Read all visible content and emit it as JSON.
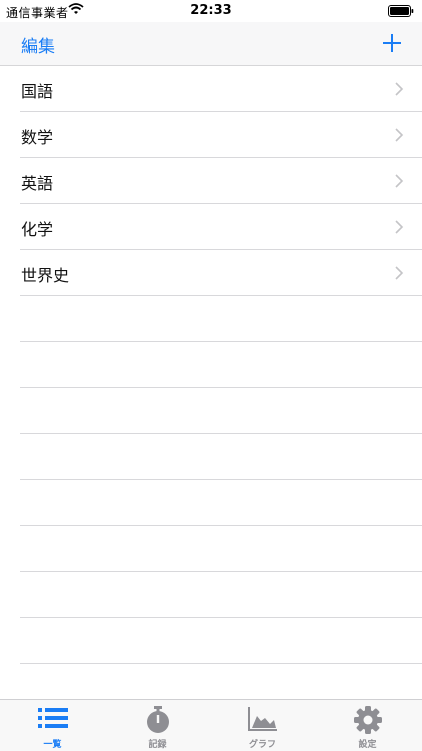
{
  "status": {
    "carrier": "通信事業者",
    "time": "22:33"
  },
  "nav": {
    "edit_label": "編集"
  },
  "subjects": [
    {
      "label": "国語"
    },
    {
      "label": "数学"
    },
    {
      "label": "英語"
    },
    {
      "label": "化学"
    },
    {
      "label": "世界史"
    }
  ],
  "tabs": [
    {
      "label": "一覧",
      "icon": "list-icon",
      "active": true
    },
    {
      "label": "記録",
      "icon": "stopwatch-icon",
      "active": false
    },
    {
      "label": "グラフ",
      "icon": "area-chart-icon",
      "active": false
    },
    {
      "label": "設定",
      "icon": "gear-icon",
      "active": false
    }
  ],
  "colors": {
    "accent": "#1a7df5",
    "inactive": "#8e8e93"
  }
}
